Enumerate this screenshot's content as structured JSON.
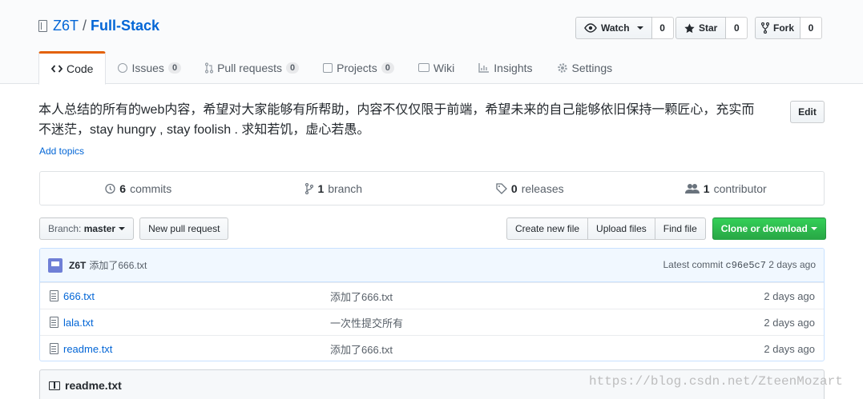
{
  "repo": {
    "owner": "Z6T",
    "separator": "/",
    "name": "Full-Stack"
  },
  "actions": {
    "watch_label": "Watch",
    "watch_count": "0",
    "star_label": "Star",
    "star_count": "0",
    "fork_label": "Fork",
    "fork_count": "0"
  },
  "tabs": [
    {
      "label": "Code",
      "icon": "code-icon"
    },
    {
      "label": "Issues",
      "count": "0",
      "icon": "issue-icon"
    },
    {
      "label": "Pull requests",
      "count": "0",
      "icon": "pull-request-icon"
    },
    {
      "label": "Projects",
      "count": "0",
      "icon": "project-icon"
    },
    {
      "label": "Wiki",
      "icon": "book-icon"
    },
    {
      "label": "Insights",
      "icon": "graph-icon"
    },
    {
      "label": "Settings",
      "icon": "gear-icon"
    }
  ],
  "description": {
    "line1": "本人总结的所有的web内容，希望对大家能够有所帮助，内容不仅仅限于前端，希望未来的自己能够依旧保持一颗匠心，充实而",
    "line2": "不迷茫，stay hungry , stay foolish . 求知若饥，虚心若愚。",
    "edit_label": "Edit",
    "add_topics": "Add topics"
  },
  "numbers": {
    "commits_count": "6",
    "commits_label": "commits",
    "branch_count": "1",
    "branch_label": "branch",
    "releases_count": "0",
    "releases_label": "releases",
    "contributor_count": "1",
    "contributor_label": "contributor"
  },
  "filebar": {
    "branch_prefix": "Branch:",
    "branch_name": "master",
    "new_pr": "New pull request",
    "create_file": "Create new file",
    "upload_files": "Upload files",
    "find_file": "Find file",
    "clone": "Clone or download"
  },
  "commit": {
    "author": "Z6T",
    "message": "添加了666.txt",
    "latest_label": "Latest commit",
    "sha": "c96e5c7",
    "age": "2 days ago"
  },
  "files": [
    {
      "name": "666.txt",
      "message": "添加了666.txt",
      "age": "2 days ago"
    },
    {
      "name": "lala.txt",
      "message": "一次性提交所有",
      "age": "2 days ago"
    },
    {
      "name": "readme.txt",
      "message": "添加了666.txt",
      "age": "2 days ago"
    }
  ],
  "readme": {
    "title": "readme.txt"
  },
  "watermark": "https://blog.csdn.net/ZteenMozart",
  "colors": {
    "link": "#0366d6",
    "active_tab_accent": "#e36209",
    "clone_button": "#28a745"
  }
}
